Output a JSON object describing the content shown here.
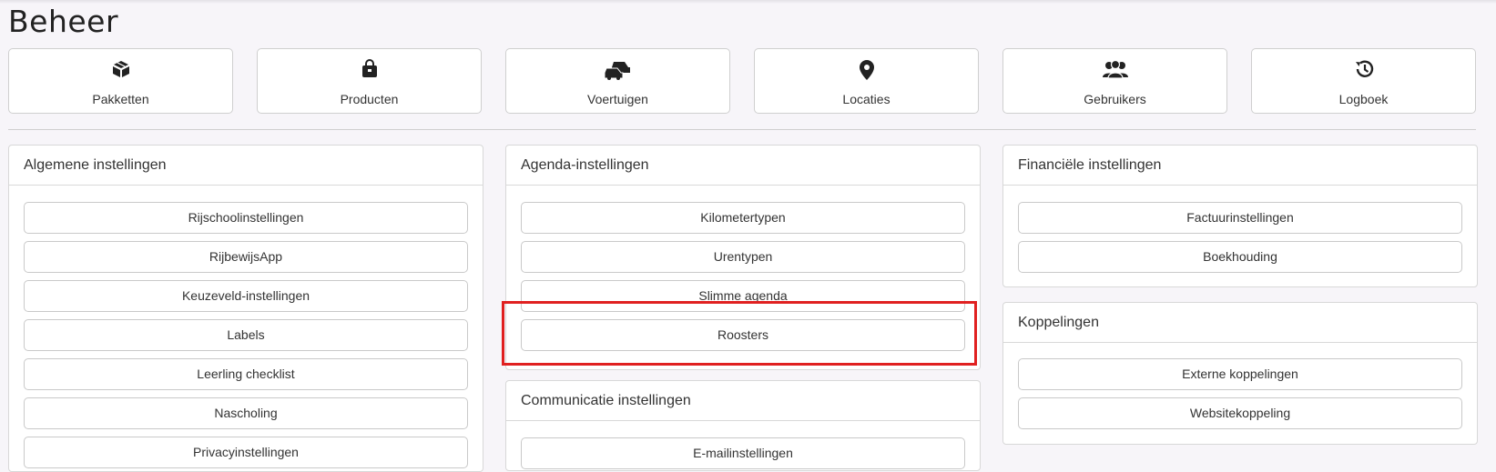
{
  "page": {
    "title": "Beheer"
  },
  "nav_tiles": [
    {
      "label": "Pakketten",
      "icon": "box-icon"
    },
    {
      "label": "Producten",
      "icon": "bag-icon"
    },
    {
      "label": "Voertuigen",
      "icon": "cars-icon"
    },
    {
      "label": "Locaties",
      "icon": "map-pin-icon"
    },
    {
      "label": "Gebruikers",
      "icon": "users-icon"
    },
    {
      "label": "Logboek",
      "icon": "history-icon"
    }
  ],
  "panels": {
    "algemene": {
      "title": "Algemene instellingen",
      "buttons": [
        "Rijschoolinstellingen",
        "RijbewijsApp",
        "Keuzeveld-instellingen",
        "Labels",
        "Leerling checklist",
        "Nascholing",
        "Privacyinstellingen"
      ]
    },
    "agenda": {
      "title": "Agenda-instellingen",
      "buttons": [
        "Kilometertypen",
        "Urentypen",
        "Slimme agenda",
        "Roosters"
      ]
    },
    "communicatie": {
      "title": "Communicatie instellingen",
      "buttons": [
        "E-mailinstellingen"
      ]
    },
    "financiele": {
      "title": "Financiële instellingen",
      "buttons": [
        "Factuurinstellingen",
        "Boekhouding"
      ]
    },
    "koppelingen": {
      "title": "Koppelingen",
      "buttons": [
        "Externe koppelingen",
        "Websitekoppeling"
      ]
    }
  },
  "colors": {
    "highlight": "#e02020",
    "background": "#f7f5f9"
  }
}
